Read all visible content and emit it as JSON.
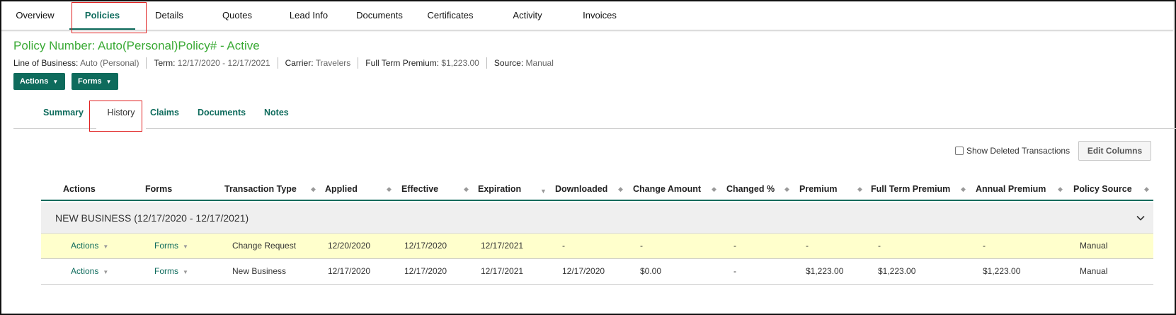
{
  "top_nav": {
    "tabs": [
      "Overview",
      "Policies",
      "Details",
      "Quotes",
      "Lead Info",
      "Documents",
      "Certificates",
      "Activity",
      "Invoices"
    ],
    "active": "Policies"
  },
  "policy": {
    "title": "Policy Number: Auto(Personal)Policy# - Active",
    "line_of_business_label": "Line of Business:",
    "line_of_business": "Auto (Personal)",
    "term_label": "Term:",
    "term": "12/17/2020 - 12/17/2021",
    "carrier_label": "Carrier:",
    "carrier": "Travelers",
    "premium_label": "Full Term Premium:",
    "premium": "$1,223.00",
    "source_label": "Source:",
    "source": "Manual"
  },
  "action_buttons": {
    "actions": "Actions",
    "forms": "Forms"
  },
  "sub_tabs": {
    "tabs": [
      "Summary",
      "History",
      "Claims",
      "Documents",
      "Notes"
    ],
    "active": "History"
  },
  "controls": {
    "show_deleted": "Show Deleted Transactions",
    "show_deleted_checked": false,
    "edit_columns": "Edit Columns"
  },
  "table": {
    "columns": [
      "Actions",
      "Forms",
      "Transaction Type",
      "Applied",
      "Effective",
      "Expiration",
      "Downloaded",
      "Change Amount",
      "Changed %",
      "Premium",
      "Full Term Premium",
      "Annual Premium",
      "Policy Source"
    ],
    "group_label": "NEW BUSINESS (12/17/2020 - 12/17/2021)",
    "rows": [
      {
        "actions": "Actions",
        "forms": "Forms",
        "transaction_type": "Change Request",
        "applied": "12/20/2020",
        "effective": "12/17/2020",
        "expiration": "12/17/2021",
        "downloaded": "-",
        "change_amount": "-",
        "changed_pct": "-",
        "premium": "-",
        "full_term_premium": "-",
        "annual_premium": "-",
        "policy_source": "Manual",
        "highlighted": true
      },
      {
        "actions": "Actions",
        "forms": "Forms",
        "transaction_type": "New Business",
        "applied": "12/17/2020",
        "effective": "12/17/2020",
        "expiration": "12/17/2021",
        "downloaded": "12/17/2020",
        "change_amount": "$0.00",
        "changed_pct": "-",
        "premium": "$1,223.00",
        "full_term_premium": "$1,223.00",
        "annual_premium": "$1,223.00",
        "policy_source": "Manual",
        "highlighted": false
      }
    ]
  },
  "colors": {
    "brand_green": "#0e6b5c",
    "title_green": "#3aaa35",
    "highlight_row": "#ffffcc",
    "annotation_red": "#e02020"
  },
  "icons": {
    "dropdown": "caret-down-icon",
    "collapse": "chevron-down-icon",
    "sort": "sort-icon"
  }
}
